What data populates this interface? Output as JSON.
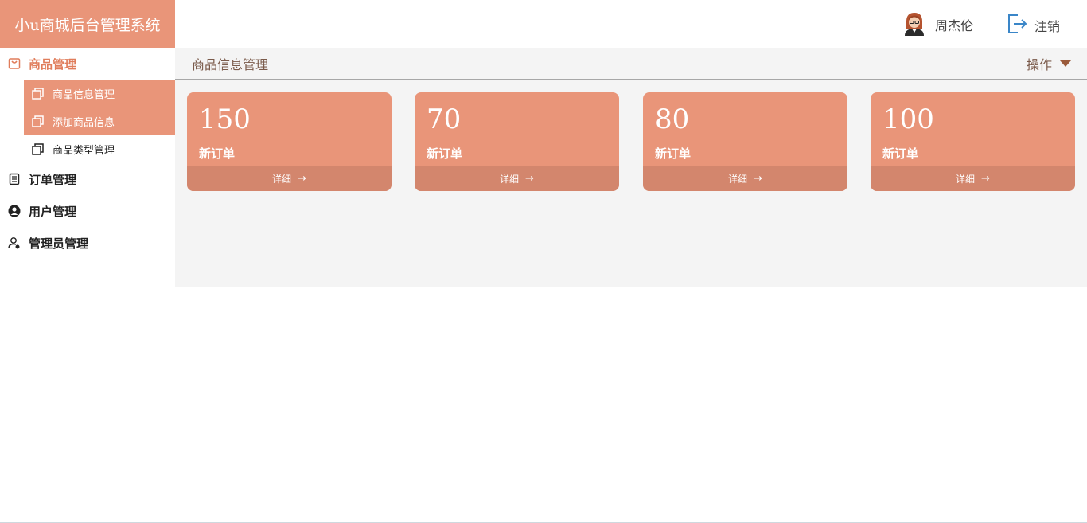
{
  "app": {
    "title": "小u商城后台管理系统"
  },
  "header": {
    "user_name": "周杰伦",
    "logout_label": "注销"
  },
  "sidebar": {
    "menus": [
      {
        "label": "商品管理",
        "icon": "shopping-bag-icon",
        "active": true,
        "items": [
          {
            "label": "商品信息管理",
            "icon": "copy-icon"
          },
          {
            "label": "添加商品信息",
            "icon": "copy-icon"
          },
          {
            "label": "商品类型管理",
            "icon": "copy-icon"
          }
        ]
      },
      {
        "label": "订单管理",
        "icon": "document-list-icon"
      },
      {
        "label": "用户管理",
        "icon": "user-circle-icon"
      },
      {
        "label": "管理员管理",
        "icon": "admin-user-icon"
      }
    ]
  },
  "main": {
    "breadcrumb": "商品信息管理",
    "operations_label": "操作",
    "cards": [
      {
        "value": "150",
        "label": "新订单",
        "detail": "详细",
        "arrow": "→"
      },
      {
        "value": "70",
        "label": "新订单",
        "detail": "详细",
        "arrow": "→"
      },
      {
        "value": "80",
        "label": "新订单",
        "detail": "详细",
        "arrow": "→"
      },
      {
        "value": "100",
        "label": "新订单",
        "detail": "详细",
        "arrow": "→"
      }
    ]
  },
  "colors": {
    "accent": "#e99579",
    "accent_dark": "#d3866d",
    "active_text": "#e07d5b",
    "main_bg": "#f4f4f4"
  }
}
